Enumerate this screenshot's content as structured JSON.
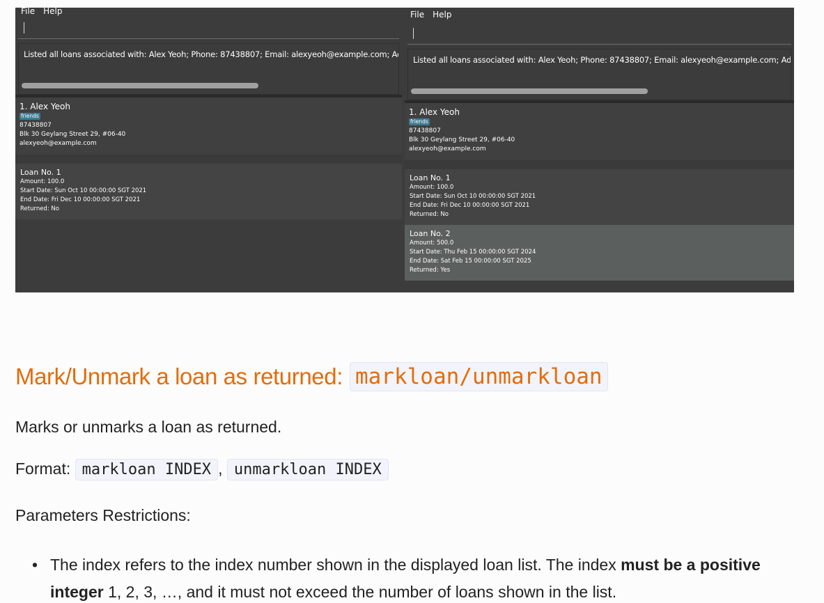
{
  "screenshots": {
    "left": {
      "menu": [
        "File",
        "Help"
      ],
      "result_text": "Listed all loans associated with: Alex Yeoh; Phone: 87438807; Email: alexyeoh@example.com; Ad",
      "person": {
        "name": "1. Alex Yeoh",
        "tag": "friends",
        "phone": "87438807",
        "address": "Blk 30 Geylang Street 29, #06-40",
        "email": "alexyeoh@example.com"
      },
      "loans": [
        {
          "title": "Loan No. 1",
          "amount": "Amount: 100.0",
          "start": "Start Date: Sun Oct 10 00:00:00 SGT 2021",
          "end": "End Date: Fri Dec 10 00:00:00 SGT 2021",
          "returned": "Returned: No"
        }
      ]
    },
    "right": {
      "menu": [
        "File",
        "Help"
      ],
      "result_text": "Listed all loans associated with: Alex Yeoh; Phone: 87438807; Email: alexyeoh@example.com; Ad",
      "person": {
        "name": "1. Alex Yeoh",
        "tag": "friends",
        "phone": "87438807",
        "address": "Blk 30 Geylang Street 29, #06-40",
        "email": "alexyeoh@example.com"
      },
      "loans": [
        {
          "title": "Loan No. 1",
          "amount": "Amount: 100.0",
          "start": "Start Date: Sun Oct 10 00:00:00 SGT 2021",
          "end": "End Date: Fri Dec 10 00:00:00 SGT 2021",
          "returned": "Returned: No"
        },
        {
          "title": "Loan No. 2",
          "amount": "Amount: 500.0",
          "start": "Start Date: Thu Feb 15 00:00:00 SGT 2024",
          "end": "End Date: Sat Feb 15 00:00:00 SGT 2025",
          "returned": "Returned: Yes"
        }
      ]
    }
  },
  "section": {
    "heading": "Mark/Unmark a loan as returned:",
    "heading_code": "markloan/unmarkloan",
    "description": "Marks or unmarks a loan as returned.",
    "format_label": "Format:",
    "format_code_1": "markloan INDEX",
    "format_sep": ",",
    "format_code_2": "unmarkloan INDEX",
    "params_label": "Parameters Restrictions:",
    "bullet": {
      "part1": "The index refers to the index number shown in the displayed loan list. The index ",
      "bold": "must be a positive integer",
      "part2": " 1, 2, 3, …, and it must not exceed the number of loans shown in the list."
    }
  },
  "colors": {
    "heading": "#e46c0a",
    "app_bg": "#3c3c3c",
    "tag_bg": "#3e7b91",
    "selected_loan": "#5b605f"
  }
}
